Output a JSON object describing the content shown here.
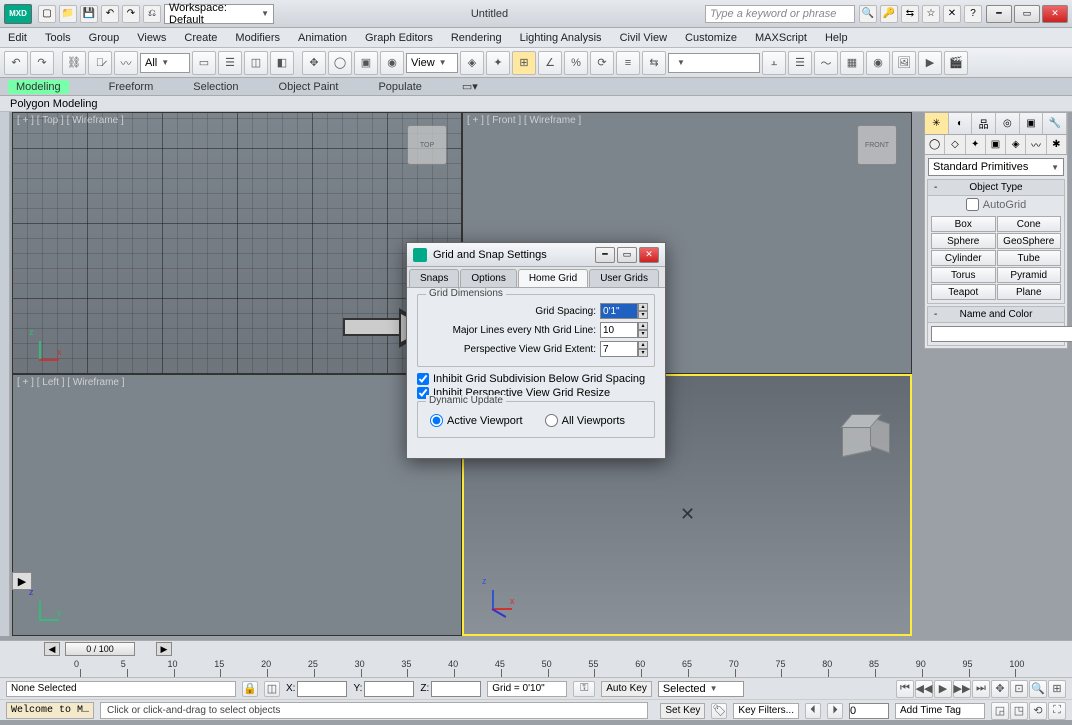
{
  "title": "Untitled",
  "app_badge": "MXD",
  "workspace": {
    "label": "Workspace: Default"
  },
  "search_placeholder": "Type a keyword or phrase",
  "menus": [
    "Edit",
    "Tools",
    "Group",
    "Views",
    "Create",
    "Modifiers",
    "Animation",
    "Graph Editors",
    "Rendering",
    "Lighting Analysis",
    "Civil View",
    "Customize",
    "MAXScript",
    "Help"
  ],
  "toolbar": {
    "sel_filter": "All",
    "ref_coord": "View"
  },
  "ribbon_tabs": [
    "Modeling",
    "Freeform",
    "Selection",
    "Object Paint",
    "Populate"
  ],
  "ribbon_active": "Modeling",
  "subribbon": "Polygon Modeling",
  "viewports": {
    "top": "[ + ] [ Top ]  [ Wireframe ]",
    "front": "[ + ] [ Front ]  [ Wireframe ]",
    "left": "[ + ] [ Left ]  [ Wireframe ]",
    "cube_top": "TOP",
    "cube_front": "FRONT"
  },
  "dialog": {
    "title": "Grid and Snap Settings",
    "tabs": [
      "Snaps",
      "Options",
      "Home Grid",
      "User Grids"
    ],
    "active_tab": "Home Grid",
    "group1": "Grid Dimensions",
    "grid_spacing_lbl": "Grid Spacing:",
    "grid_spacing_val": "0'1\"",
    "major_lbl": "Major Lines every Nth Grid Line:",
    "major_val": "10",
    "extent_lbl": "Perspective View Grid Extent:",
    "extent_val": "7",
    "chk1": "Inhibit Grid Subdivision Below Grid Spacing",
    "chk2": "Inhibit Perspective View Grid Resize",
    "group2": "Dynamic Update",
    "rad1": "Active Viewport",
    "rad2": "All Viewports"
  },
  "cmd": {
    "dropdown": "Standard Primitives",
    "roll1": "Object Type",
    "autogrid": "AutoGrid",
    "buttons": [
      "Box",
      "Cone",
      "Sphere",
      "GeoSphere",
      "Cylinder",
      "Tube",
      "Torus",
      "Pyramid",
      "Teapot",
      "Plane"
    ],
    "roll2": "Name and Color"
  },
  "timeline": {
    "slider": "0 / 100",
    "ticks": [
      "0",
      "5",
      "10",
      "15",
      "20",
      "25",
      "30",
      "35",
      "40",
      "45",
      "50",
      "55",
      "60",
      "65",
      "70",
      "75",
      "80",
      "85",
      "90",
      "95",
      "100"
    ]
  },
  "status": {
    "selection": "None Selected",
    "x": "X:",
    "y": "Y:",
    "z": "Z:",
    "grid": "Grid = 0'10\"",
    "autokey": "Auto Key",
    "selected": "Selected",
    "setkey": "Set Key",
    "keyfilters": "Key Filters...",
    "frame": "0",
    "addtag": "Add Time Tag",
    "welcome": "Welcome to M…",
    "prompt": "Click or click-and-drag to select objects"
  }
}
